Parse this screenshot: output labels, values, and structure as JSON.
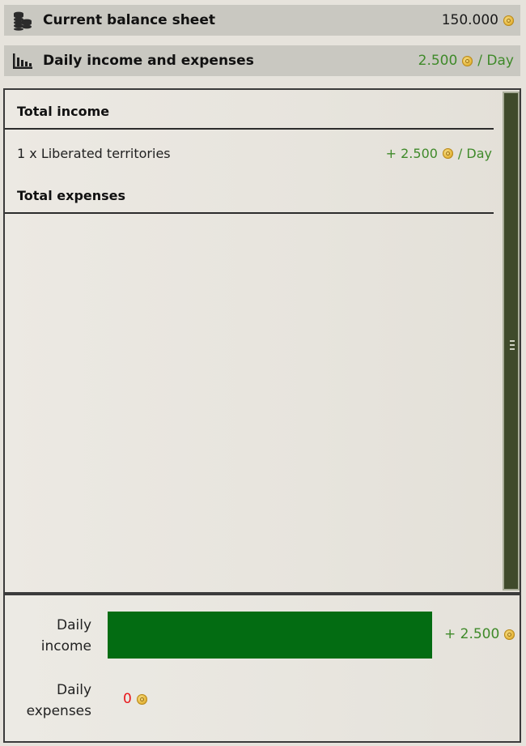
{
  "balance": {
    "title": "Current balance sheet",
    "value": "150.000",
    "icon": "coins-stack-icon"
  },
  "daily": {
    "title": "Daily income and expenses",
    "value": "2.500",
    "per": "/ Day",
    "icon": "bar-chart-icon"
  },
  "income_section": {
    "title": "Total income",
    "items": [
      {
        "label": "1 x Liberated territories",
        "value": "+ 2.500",
        "per": "/ Day"
      }
    ]
  },
  "expenses_section": {
    "title": "Total expenses",
    "items": []
  },
  "summary": {
    "income_label_line1": "Daily",
    "income_label_line2": "income",
    "income_value": "+ 2.500",
    "income_fraction": 1.0,
    "expenses_label_line1": "Daily",
    "expenses_label_line2": "expenses",
    "expenses_value": "0",
    "expenses_fraction": 0.0
  },
  "colors": {
    "positive": "#3f8a2a",
    "negative": "#e8161a",
    "income_bar": "#036c12",
    "scrollbar": "#3f4a2b"
  }
}
